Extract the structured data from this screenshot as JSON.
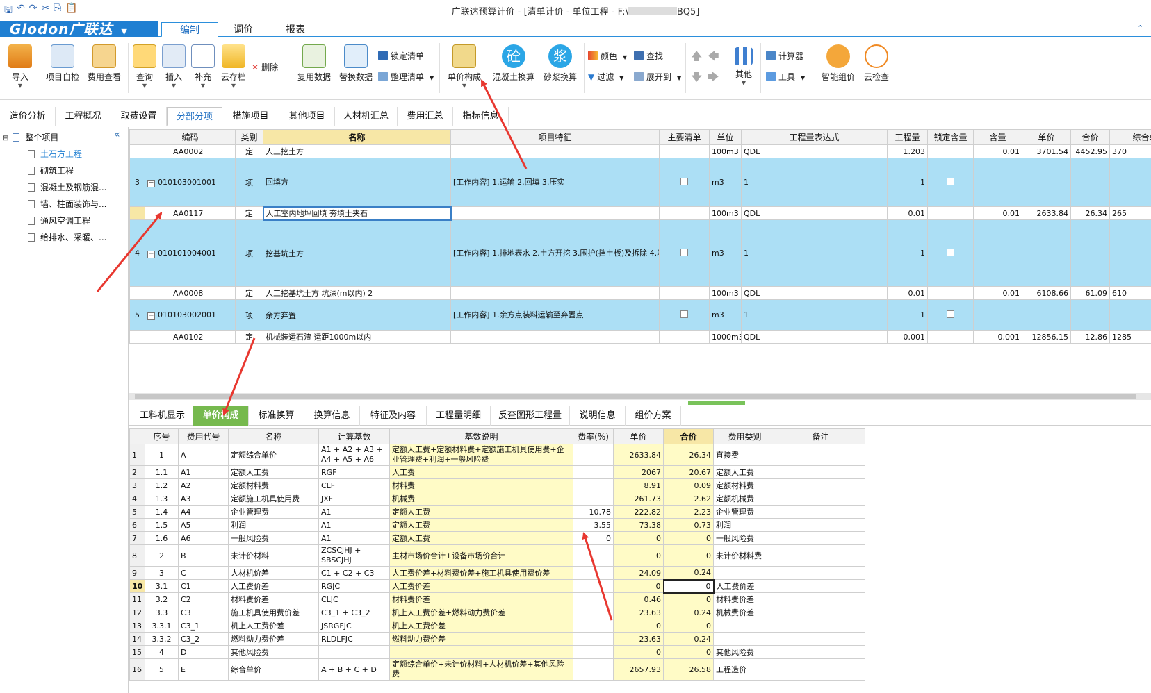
{
  "title": "广联达预算计价 - [清单计价 - 单位工程 - F:\\",
  "title_tail": "BQ5]",
  "brand": "Glodon广联达",
  "menu_tabs": [
    "编制",
    "调价",
    "报表"
  ],
  "ribbon": {
    "import": "导入",
    "self_check": "项目自检",
    "cost_view": "费用查看",
    "query": "查询",
    "insert": "插入",
    "supplement": "补充",
    "cloud_save": "云存档",
    "delete": "删除",
    "reuse": "复用数据",
    "replace": "替换数据",
    "lock_list": "锁定清单",
    "organize_list": "整理清单",
    "unit_price": "单价构成",
    "concrete": "混凝土换算",
    "mortar": "砂浆换算",
    "concrete_glyph": "砼",
    "mortar_glyph": "浆",
    "color": "颜色",
    "find": "查找",
    "filter": "过滤",
    "expand": "展开到",
    "other": "其他",
    "calculator": "计算器",
    "tools": "工具",
    "smart_price": "智能组价",
    "cloud_check": "云检查"
  },
  "view_tabs": [
    "造价分析",
    "工程概况",
    "取费设置",
    "分部分项",
    "措施项目",
    "其他项目",
    "人材机汇总",
    "费用汇总",
    "指标信息"
  ],
  "tree": {
    "root": "整个项目",
    "items": [
      "土石方工程",
      "砌筑工程",
      "混凝土及钢筋混...",
      "墙、柱面装饰与...",
      "通风空调工程",
      "给排水、采暖、..."
    ]
  },
  "grid1": {
    "headers": [
      "编码",
      "类别",
      "名称",
      "项目特征",
      "主要清单",
      "单位",
      "工程量表达式",
      "工程量",
      "锁定含量",
      "含量",
      "单价",
      "合价",
      "综合单价"
    ],
    "rows": [
      {
        "idx": "",
        "code": "AA0002",
        "type": "定",
        "name": "人工挖土方",
        "feature": "",
        "unit": "100m3",
        "expr": "QDL",
        "qty": "1.203",
        "content": "0.01",
        "price": "3701.54",
        "total": "4452.95",
        "comp": "370"
      },
      {
        "idx": "3",
        "code": "010103001001",
        "type": "项",
        "name": "回填方",
        "feature": "[工作内容]\n1.运输\n2.回填\n3.压实",
        "unit": "m3",
        "expr": "1",
        "qty": "1",
        "content": "",
        "price": "",
        "total": "",
        "comp": "2"
      },
      {
        "idx": "",
        "code": "AA0117",
        "type": "定",
        "name": "人工室内地坪回填 夯填土夹石",
        "feature": "",
        "unit": "100m3",
        "expr": "QDL",
        "qty": "0.01",
        "content": "0.01",
        "price": "2633.84",
        "total": "26.34",
        "comp": "265"
      },
      {
        "idx": "4",
        "code": "010101004001",
        "type": "项",
        "name": "挖基坑土方",
        "feature": "[工作内容]\n1.排地表水\n2.土方开挖\n3.围护(挡土板)及拆除\n4.基底钎探\n5.场内运输",
        "unit": "m3",
        "expr": "1",
        "qty": "1",
        "content": "",
        "price": "",
        "total": "",
        "comp": "6"
      },
      {
        "idx": "",
        "code": "AA0008",
        "type": "定",
        "name": "人工挖基坑土方 坑深(m以内) 2",
        "feature": "",
        "unit": "100m3",
        "expr": "QDL",
        "qty": "0.01",
        "content": "0.01",
        "price": "6108.66",
        "total": "61.09",
        "comp": "610"
      },
      {
        "idx": "5",
        "code": "010103002001",
        "type": "项",
        "name": "余方弃置",
        "feature": "[工作内容]\n1.余方点装料运输至弃置点",
        "unit": "m3",
        "expr": "1",
        "qty": "1",
        "content": "",
        "price": "",
        "total": "",
        "comp": "1"
      },
      {
        "idx": "",
        "code": "AA0102",
        "type": "定",
        "name": "机械装运石渣 运距1000m以内",
        "feature": "",
        "unit": "1000m3",
        "expr": "QDL",
        "qty": "0.001",
        "content": "0.001",
        "price": "12856.15",
        "total": "12.86",
        "comp": "1285"
      }
    ]
  },
  "bottom_tabs": [
    "工料机显示",
    "单价构成",
    "标准换算",
    "换算信息",
    "特征及内容",
    "工程量明细",
    "反查图形工程量",
    "说明信息",
    "组价方案"
  ],
  "grid2": {
    "headers": [
      "序号",
      "费用代号",
      "名称",
      "计算基数",
      "基数说明",
      "费率(%)",
      "单价",
      "合价",
      "费用类别",
      "备注"
    ],
    "rows": [
      {
        "n": "1",
        "seq": "1",
        "code": "A",
        "name": "定额综合单价",
        "base": "A1 + A2 + A3 + A4 + A5 + A6",
        "desc": "定额人工费+定额材料费+定额施工机具使用费+企业管理费+利润+一般风险费",
        "rate": "",
        "price": "2633.84",
        "total": "26.34",
        "cat": "直接费"
      },
      {
        "n": "2",
        "seq": "1.1",
        "code": "A1",
        "name": "定额人工费",
        "base": "RGF",
        "desc": "人工费",
        "rate": "",
        "price": "2067",
        "total": "20.67",
        "cat": "定额人工费"
      },
      {
        "n": "3",
        "seq": "1.2",
        "code": "A2",
        "name": "定额材料费",
        "base": "CLF",
        "desc": "材料费",
        "rate": "",
        "price": "8.91",
        "total": "0.09",
        "cat": "定额材料费"
      },
      {
        "n": "4",
        "seq": "1.3",
        "code": "A3",
        "name": "定额施工机具使用费",
        "base": "JXF",
        "desc": "机械费",
        "rate": "",
        "price": "261.73",
        "total": "2.62",
        "cat": "定额机械费"
      },
      {
        "n": "5",
        "seq": "1.4",
        "code": "A4",
        "name": "企业管理费",
        "base": "A1",
        "desc": "定额人工费",
        "rate": "10.78",
        "price": "222.82",
        "total": "2.23",
        "cat": "企业管理费"
      },
      {
        "n": "6",
        "seq": "1.5",
        "code": "A5",
        "name": "利润",
        "base": "A1",
        "desc": "定额人工费",
        "rate": "3.55",
        "price": "73.38",
        "total": "0.73",
        "cat": "利润"
      },
      {
        "n": "7",
        "seq": "1.6",
        "code": "A6",
        "name": "一般风险费",
        "base": "A1",
        "desc": "定额人工费",
        "rate": "0",
        "price": "0",
        "total": "0",
        "cat": "一般风险费"
      },
      {
        "n": "8",
        "seq": "2",
        "code": "B",
        "name": "未计价材料",
        "base": "ZCSCJHJ + SBSCJHJ",
        "desc": "主材市场价合计+设备市场价合计",
        "rate": "",
        "price": "0",
        "total": "0",
        "cat": "未计价材料费"
      },
      {
        "n": "9",
        "seq": "3",
        "code": "C",
        "name": "人材机价差",
        "base": "C1 + C2 + C3",
        "desc": "人工费价差+材料费价差+施工机具使用费价差",
        "rate": "",
        "price": "24.09",
        "total": "0.24",
        "cat": ""
      },
      {
        "n": "10",
        "seq": "3.1",
        "code": "C1",
        "name": "人工费价差",
        "base": "RGJC",
        "desc": "人工费价差",
        "rate": "",
        "price": "0",
        "total": "0",
        "cat": "人工费价差"
      },
      {
        "n": "11",
        "seq": "3.2",
        "code": "C2",
        "name": "材料费价差",
        "base": "CLJC",
        "desc": "材料费价差",
        "rate": "",
        "price": "0.46",
        "total": "0",
        "cat": "材料费价差"
      },
      {
        "n": "12",
        "seq": "3.3",
        "code": "C3",
        "name": "施工机具使用费价差",
        "base": "C3_1 + C3_2",
        "desc": "机上人工费价差+燃料动力费价差",
        "rate": "",
        "price": "23.63",
        "total": "0.24",
        "cat": "机械费价差"
      },
      {
        "n": "13",
        "seq": "3.3.1",
        "code": "C3_1",
        "name": "机上人工费价差",
        "base": "JSRGFJC",
        "desc": "机上人工费价差",
        "rate": "",
        "price": "0",
        "total": "0",
        "cat": ""
      },
      {
        "n": "14",
        "seq": "3.3.2",
        "code": "C3_2",
        "name": "燃料动力费价差",
        "base": "RLDLFJC",
        "desc": "燃料动力费价差",
        "rate": "",
        "price": "23.63",
        "total": "0.24",
        "cat": ""
      },
      {
        "n": "15",
        "seq": "4",
        "code": "D",
        "name": "其他风险费",
        "base": "",
        "desc": "",
        "rate": "",
        "price": "0",
        "total": "0",
        "cat": "其他风险费"
      },
      {
        "n": "16",
        "seq": "5",
        "code": "E",
        "name": "综合单价",
        "base": "A + B + C + D",
        "desc": "定额综合单价+未计价材料+人材机价差+其他风险费",
        "rate": "",
        "price": "2657.93",
        "total": "26.58",
        "cat": "工程造价"
      }
    ]
  },
  "colors": {
    "accent": "#1f7fd2",
    "item_row": "#acdff5",
    "yellow_cell": "#fffbc6",
    "active_tab": "#76b94e",
    "arrow": "#e8372f"
  },
  "icons": [
    "save-icon",
    "undo-icon",
    "redo-icon",
    "cut-icon",
    "copy-icon",
    "paste-icon",
    "import-icon",
    "self-check-icon",
    "cost-view-icon",
    "query-icon",
    "insert-icon",
    "supplement-icon",
    "cloud-save-icon",
    "delete-icon",
    "reuse-icon",
    "replace-icon",
    "lock-icon",
    "organize-icon",
    "unit-price-icon",
    "concrete-icon",
    "mortar-icon",
    "color-icon",
    "find-icon",
    "filter-icon",
    "expand-icon",
    "move-up-icon",
    "move-left-icon",
    "move-down-icon",
    "move-right-icon",
    "other-icon",
    "calculator-icon",
    "tools-icon",
    "smart-price-icon",
    "cloud-check-icon",
    "collapse-icon",
    "document-icon",
    "checkbox-icon",
    "collapse-row-icon",
    "red-arrow-annotation-icon"
  ]
}
